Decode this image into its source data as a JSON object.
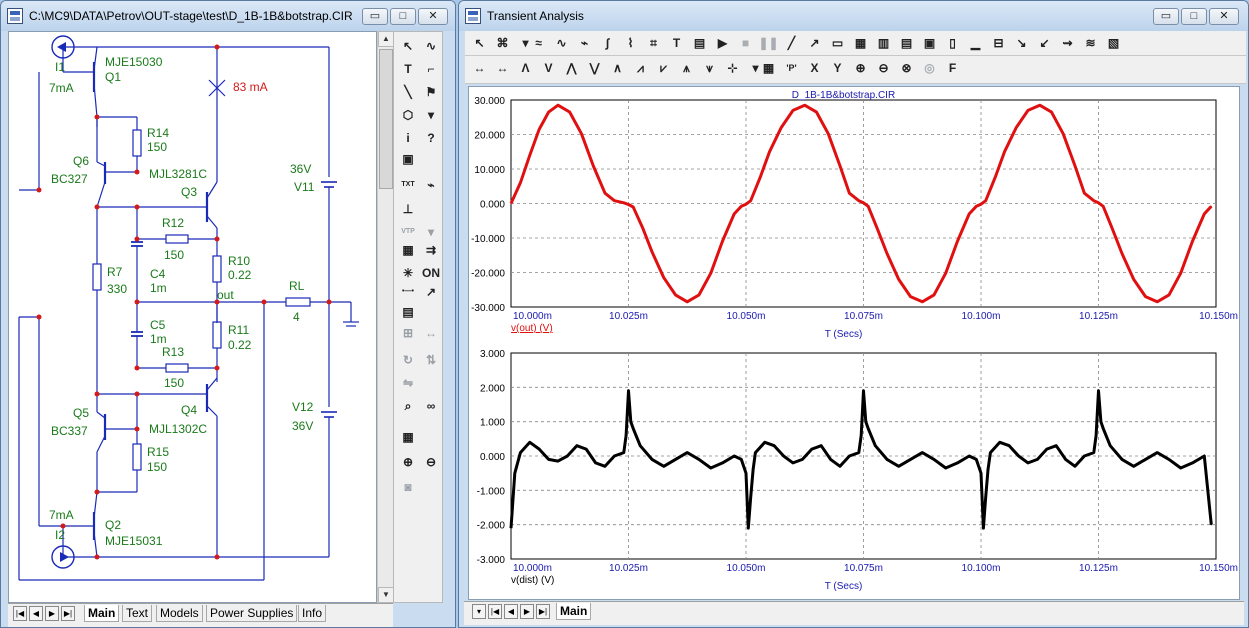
{
  "colors": {
    "wire": "#1a2ab8",
    "label": "#1a7a1a",
    "current": "#d41a1a",
    "node": "#d41a1a",
    "trace1": "#e01010",
    "trace2": "#000000",
    "axis": "#1a1ab0"
  },
  "schematic_window": {
    "title": "C:\\MC9\\DATA\\Petrov\\OUT-stage\\test\\D_1B-1B&botstrap.CIR",
    "controls": {
      "minimize": "▭",
      "maximize": "□",
      "close": "✕"
    },
    "labels": {
      "i1": "I1",
      "i1_val": "7mA",
      "q1_type": "MJE15030",
      "q1": "Q1",
      "r14": "R14",
      "r14_val": "150",
      "q6": "Q6",
      "q6_type": "BC327",
      "q3_type": "MJL3281C",
      "q3": "Q3",
      "current": "83 mA",
      "v11_val": "36V",
      "v11": "V11",
      "r12": "R12",
      "r12_val": "150",
      "r10": "R10",
      "r10_val": "0.22",
      "r7": "R7",
      "r7_val": "330",
      "c4": "C4",
      "c4_val": "1m",
      "out": "out",
      "rl": "RL",
      "rl_val": "4",
      "c5": "C5",
      "c5_val": "1m",
      "r11": "R11",
      "r11_val": "0.22",
      "r13": "R13",
      "r13_val": "150",
      "q5": "Q5",
      "q5_type": "BC337",
      "q4": "Q4",
      "q4_type": "MJL1302C",
      "v12": "V12",
      "v12_val": "36V",
      "r15": "R15",
      "r15_val": "150",
      "i2_val": "7mA",
      "i2": "I2",
      "q2": "Q2",
      "q2_type": "MJE15031"
    },
    "tabs": [
      "Main",
      "Text",
      "Models",
      "Power Supplies",
      "Info"
    ],
    "active_tab": "Main",
    "nav_buttons": [
      "|◀",
      "◀",
      "▶",
      "▶|"
    ]
  },
  "palette": {
    "items": [
      {
        "name": "select-arrow-icon",
        "glyph": "↖"
      },
      {
        "name": "wave-icon",
        "glyph": "∿"
      },
      {
        "name": "text-tool-icon",
        "glyph": "T"
      },
      {
        "name": "wire-corner-icon",
        "glyph": "⌐"
      },
      {
        "name": "diagonal-wire-icon",
        "glyph": "╲"
      },
      {
        "name": "flag-icon",
        "glyph": "⚑"
      },
      {
        "name": "components-icon",
        "glyph": "⬡"
      },
      {
        "name": "dropdown-arrow-icon",
        "glyph": "▾"
      },
      {
        "name": "info-icon",
        "glyph": "i"
      },
      {
        "name": "help-cursor-icon",
        "glyph": "?"
      },
      {
        "name": "run-check-icon",
        "glyph": "▣"
      },
      {
        "name": "empty-slot",
        "glyph": ""
      },
      {
        "name": "text-label-icon",
        "glyph": "TXT"
      },
      {
        "name": "probe-icon",
        "glyph": "⌁"
      },
      {
        "name": "pin-icon",
        "glyph": "⊥"
      },
      {
        "name": "empty-slot-2",
        "glyph": ""
      },
      {
        "name": "vtp-icon",
        "glyph": "VTP"
      },
      {
        "name": "dropdown-arrow-2-icon",
        "glyph": "▾"
      },
      {
        "name": "grid-toggle-icon",
        "glyph": "▦"
      },
      {
        "name": "wire-arrow-icon",
        "glyph": "⇉"
      },
      {
        "name": "light-icon",
        "glyph": "✳"
      },
      {
        "name": "on-switch-icon",
        "glyph": "ON"
      },
      {
        "name": "node-icon",
        "glyph": "•—•"
      },
      {
        "name": "cursor-mode-icon",
        "glyph": "↗"
      },
      {
        "name": "properties-icon",
        "glyph": "▤"
      },
      {
        "name": "empty-slot-3",
        "glyph": ""
      },
      {
        "name": "select-group-icon",
        "glyph": "⊞"
      },
      {
        "name": "swap-icon",
        "glyph": "↔"
      },
      {
        "name": "rotate-icon",
        "glyph": "↻"
      },
      {
        "name": "flip-icon",
        "glyph": "⇅"
      },
      {
        "name": "mirror-icon",
        "glyph": "⇋"
      },
      {
        "name": "empty-slot-4",
        "glyph": ""
      },
      {
        "name": "find-icon",
        "glyph": "⌕"
      },
      {
        "name": "binoculars-icon",
        "glyph": "∞"
      },
      {
        "name": "notes-icon",
        "glyph": "▦"
      },
      {
        "name": "empty-slot-5",
        "glyph": ""
      },
      {
        "name": "zoom-in-icon",
        "glyph": "⊕"
      },
      {
        "name": "zoom-out-icon",
        "glyph": "⊖"
      },
      {
        "name": "camera-icon",
        "glyph": "◙"
      },
      {
        "name": "empty-slot-6",
        "glyph": ""
      }
    ]
  },
  "analysis_window": {
    "title": "Transient Analysis",
    "controls": {
      "minimize": "▭",
      "maximize": "□",
      "close": "✕"
    },
    "toolbar1": [
      {
        "name": "select-arrow-tool",
        "glyph": "↖"
      },
      {
        "name": "multi-plot-tool",
        "glyph": "⌘"
      },
      {
        "name": "dropdown-tool",
        "glyph": "▾"
      },
      {
        "name": "scale-wave-tool",
        "glyph": "≈"
      },
      {
        "name": "wave-select-tool",
        "glyph": "∿"
      },
      {
        "name": "wave-data-tool",
        "glyph": "⌁"
      },
      {
        "name": "wave-tag-tool",
        "glyph": "∫"
      },
      {
        "name": "wave-label-tool",
        "glyph": "⌇"
      },
      {
        "name": "wave-mark-tool",
        "glyph": "⌗"
      },
      {
        "name": "text-tool",
        "glyph": "T"
      },
      {
        "name": "properties-tool",
        "glyph": "▤"
      },
      {
        "name": "run-tool",
        "glyph": "▶"
      },
      {
        "name": "stop-tool",
        "glyph": "■"
      },
      {
        "name": "pause-tool",
        "glyph": "❚❚"
      },
      {
        "name": "line-tool",
        "glyph": "╱"
      },
      {
        "name": "arrow-line-tool",
        "glyph": "↗"
      },
      {
        "name": "box-tool",
        "glyph": "▭"
      },
      {
        "name": "grid-tool",
        "glyph": "▦"
      },
      {
        "name": "bar-grid-tool",
        "glyph": "▥"
      },
      {
        "name": "table-tool",
        "glyph": "▤"
      },
      {
        "name": "box-grid-tool",
        "glyph": "▣"
      },
      {
        "name": "column-tool",
        "glyph": "▯"
      },
      {
        "name": "baseline-tool",
        "glyph": "▁"
      },
      {
        "name": "split-tool",
        "glyph": "⊟"
      },
      {
        "name": "scale-x-tool",
        "glyph": "↘"
      },
      {
        "name": "scale-y-tool",
        "glyph": "↙"
      },
      {
        "name": "peak-tool",
        "glyph": "⇝"
      },
      {
        "name": "slope-tool",
        "glyph": "≋"
      },
      {
        "name": "chart-options-tool",
        "glyph": "▧"
      }
    ],
    "toolbar2": [
      {
        "name": "cursor-left-tool",
        "glyph": "↔"
      },
      {
        "name": "cursor-right-tool",
        "glyph": "↔"
      },
      {
        "name": "peak-find-tool",
        "glyph": "Λ"
      },
      {
        "name": "valley-find-tool",
        "glyph": "V"
      },
      {
        "name": "high-tool",
        "glyph": "⋀"
      },
      {
        "name": "low-tool",
        "glyph": "⋁"
      },
      {
        "name": "inflection-tool",
        "glyph": "∧"
      },
      {
        "name": "global-high-tool",
        "glyph": "⩘"
      },
      {
        "name": "global-low-tool",
        "glyph": "⩗"
      },
      {
        "name": "top-tool",
        "glyph": "⩚"
      },
      {
        "name": "bottom-tool",
        "glyph": "⩛"
      },
      {
        "name": "data-points-tool",
        "glyph": "⊹"
      },
      {
        "name": "dropdown-2-tool",
        "glyph": "▾"
      },
      {
        "name": "numeric-tool",
        "glyph": "▦"
      },
      {
        "name": "p-key-tool",
        "glyph": "'P'"
      },
      {
        "name": "x-label-tool",
        "glyph": "X"
      },
      {
        "name": "y-label-tool",
        "glyph": "Y"
      },
      {
        "name": "zoom-in-tool",
        "glyph": "⊕"
      },
      {
        "name": "zoom-out-tool",
        "glyph": "⊖"
      },
      {
        "name": "zoom-fit-tool",
        "glyph": "⊗"
      },
      {
        "name": "target-tool",
        "glyph": "◎"
      },
      {
        "name": "font-tool",
        "glyph": "F"
      }
    ],
    "tabs": [
      "Main"
    ],
    "active_tab": "Main",
    "nav_buttons": [
      "▾",
      "|◀",
      "◀",
      "▶",
      "▶|"
    ]
  },
  "chart_data": [
    {
      "type": "line",
      "title": "D_1B-1B&botstrap.CIR",
      "xlabel": "T (Secs)",
      "ylabel": "",
      "series": [
        {
          "name": "v(out) (V)",
          "color": "#e01010"
        }
      ],
      "x": [
        10.0,
        10.002,
        10.004,
        10.006,
        10.008,
        10.01,
        10.0125,
        10.015,
        10.0175,
        10.02,
        10.022,
        10.024,
        10.025,
        10.026,
        10.028,
        10.03,
        10.0325,
        10.035,
        10.0375,
        10.04,
        10.0425,
        10.045,
        10.0475,
        10.049,
        10.05,
        10.051,
        10.053,
        10.055,
        10.0575,
        10.06,
        10.0625,
        10.065,
        10.0675,
        10.07,
        10.072,
        10.074,
        10.075,
        10.076,
        10.078,
        10.08,
        10.0825,
        10.085,
        10.0875,
        10.09,
        10.0925,
        10.095,
        10.0975,
        10.099,
        10.1,
        10.101,
        10.103,
        10.105,
        10.1075,
        10.11,
        10.1125,
        10.115,
        10.1175,
        10.12,
        10.122,
        10.124,
        10.125,
        10.126,
        10.128,
        10.13,
        10.1325,
        10.135,
        10.1375,
        10.14,
        10.1425,
        10.145,
        10.1475,
        10.149
      ],
      "y": [
        0.0,
        6.0,
        14.0,
        21.5,
        26.5,
        28.5,
        26.5,
        20.2,
        10.9,
        3.0,
        0.8,
        0.2,
        -0.3,
        -1.0,
        -7.0,
        -14.0,
        -21.5,
        -26.5,
        -28.5,
        -26.5,
        -20.2,
        -10.9,
        -3.0,
        -0.8,
        -0.2,
        0.8,
        7.5,
        15.0,
        22.0,
        27.0,
        28.5,
        26.5,
        20.2,
        10.9,
        3.0,
        0.8,
        0.2,
        -0.8,
        -7.5,
        -14.5,
        -22.0,
        -27.0,
        -28.5,
        -26.5,
        -20.2,
        -10.9,
        -3.0,
        -0.8,
        -0.2,
        0.8,
        7.5,
        15.0,
        22.0,
        27.0,
        28.5,
        26.5,
        20.2,
        10.9,
        3.0,
        0.8,
        0.2,
        -0.8,
        -7.5,
        -14.5,
        -22.0,
        -27.0,
        -28.5,
        -26.5,
        -20.2,
        -10.9,
        -3.0,
        -0.8
      ],
      "xlim": [
        10.0,
        10.15
      ],
      "ylim": [
        -30.0,
        30.0
      ],
      "xticks": [
        "10.000m",
        "10.025m",
        "10.050m",
        "10.075m",
        "10.100m",
        "10.125m",
        "10.150m"
      ],
      "yticks": [
        "30.000",
        "20.000",
        "10.000",
        "0.000",
        "-10.000",
        "-20.000",
        "-30.000"
      ],
      "grid": true
    },
    {
      "type": "line",
      "title": "",
      "xlabel": "T (Secs)",
      "ylabel": "",
      "series": [
        {
          "name": "v(dist) (V)",
          "color": "#000000"
        }
      ],
      "x": [
        10.0,
        10.0008,
        10.002,
        10.004,
        10.006,
        10.008,
        10.01,
        10.012,
        10.014,
        10.016,
        10.018,
        10.02,
        10.022,
        10.024,
        10.0245,
        10.025,
        10.0255,
        10.026,
        10.0275,
        10.03,
        10.0325,
        10.035,
        10.0375,
        10.04,
        10.0425,
        10.045,
        10.0475,
        10.049,
        10.05,
        10.0505,
        10.051,
        10.0515,
        10.052,
        10.054,
        10.056,
        10.058,
        10.06,
        10.062,
        10.064,
        10.066,
        10.068,
        10.07,
        10.072,
        10.074,
        10.0745,
        10.075,
        10.0755,
        10.076,
        10.0775,
        10.08,
        10.0825,
        10.085,
        10.0875,
        10.09,
        10.0925,
        10.095,
        10.0975,
        10.099,
        10.1,
        10.1005,
        10.101,
        10.1015,
        10.102,
        10.104,
        10.106,
        10.108,
        10.11,
        10.112,
        10.114,
        10.116,
        10.118,
        10.12,
        10.122,
        10.124,
        10.1245,
        10.125,
        10.1255,
        10.126,
        10.1275,
        10.13,
        10.1325,
        10.135,
        10.1375,
        10.14,
        10.1425,
        10.145,
        10.1475,
        10.149
      ],
      "y": [
        -2.1,
        -0.5,
        0.1,
        0.4,
        0.2,
        -0.1,
        -0.15,
        0.0,
        0.3,
        0.2,
        -0.2,
        -0.3,
        0.0,
        0.1,
        0.6,
        1.9,
        1.0,
        0.8,
        0.3,
        -0.1,
        -0.3,
        -0.1,
        0.1,
        -0.1,
        -0.35,
        -0.2,
        0.0,
        -0.1,
        -0.5,
        -2.1,
        -1.2,
        -0.4,
        0.1,
        0.4,
        0.3,
        0.0,
        -0.2,
        -0.1,
        0.2,
        0.3,
        -0.1,
        -0.3,
        0.0,
        0.1,
        0.6,
        1.9,
        1.0,
        0.8,
        0.3,
        -0.1,
        -0.3,
        -0.1,
        0.1,
        -0.1,
        -0.35,
        -0.2,
        0.0,
        -0.1,
        -0.5,
        -2.1,
        -1.2,
        -0.4,
        0.1,
        0.4,
        0.3,
        0.0,
        -0.2,
        -0.1,
        0.2,
        0.3,
        -0.1,
        -0.3,
        0.0,
        0.1,
        0.6,
        1.9,
        1.0,
        0.8,
        0.3,
        -0.1,
        -0.3,
        -0.1,
        0.1,
        -0.1,
        -0.35,
        -0.2,
        0.0,
        -2.0
      ],
      "xlim": [
        10.0,
        10.15
      ],
      "ylim": [
        -3.0,
        3.0
      ],
      "xticks": [
        "10.000m",
        "10.025m",
        "10.050m",
        "10.075m",
        "10.100m",
        "10.125m",
        "10.150m"
      ],
      "yticks": [
        "3.000",
        "2.000",
        "1.000",
        "0.000",
        "-1.000",
        "-2.000",
        "-3.000"
      ],
      "grid": true
    }
  ]
}
